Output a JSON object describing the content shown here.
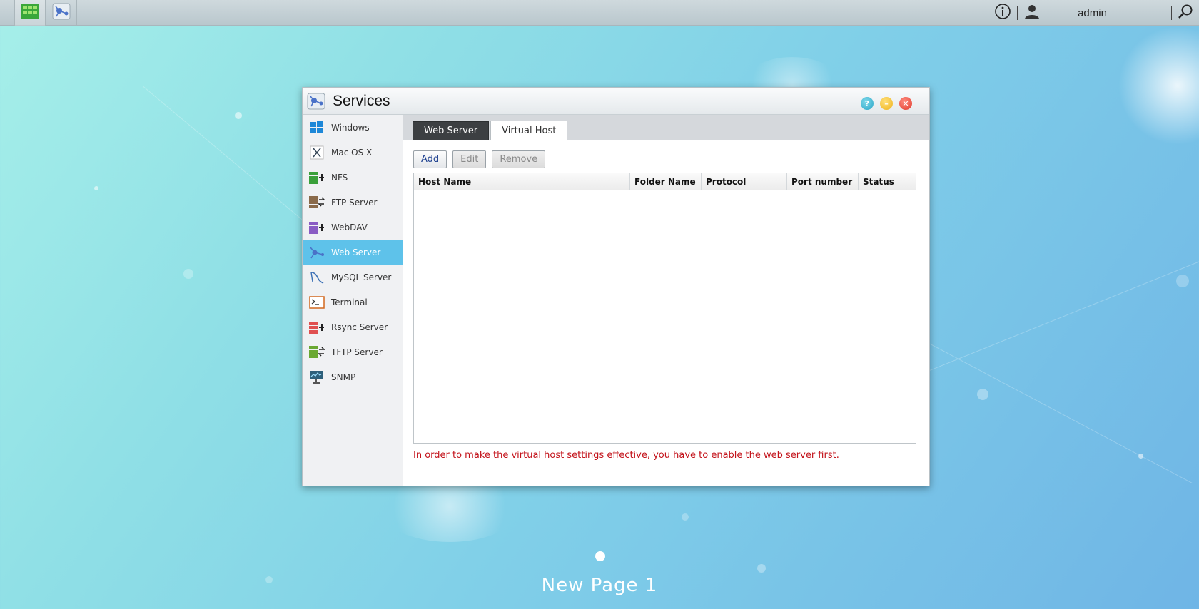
{
  "taskbar": {
    "apps": [
      {
        "name": "grid-app-icon"
      },
      {
        "name": "services-app-icon"
      }
    ],
    "user": "admin"
  },
  "window": {
    "title": "Services",
    "controls": [
      "help",
      "minimize",
      "close"
    ]
  },
  "sidebar": {
    "items": [
      {
        "label": "Windows",
        "icon": "windows-icon"
      },
      {
        "label": "Mac OS X",
        "icon": "mac-os-x-icon"
      },
      {
        "label": "NFS",
        "icon": "nfs-icon"
      },
      {
        "label": "FTP Server",
        "icon": "ftp-server-icon"
      },
      {
        "label": "WebDAV",
        "icon": "webdav-icon"
      },
      {
        "label": "Web Server",
        "icon": "web-server-icon",
        "active": true
      },
      {
        "label": "MySQL Server",
        "icon": "mysql-server-icon"
      },
      {
        "label": "Terminal",
        "icon": "terminal-icon"
      },
      {
        "label": "Rsync Server",
        "icon": "rsync-server-icon"
      },
      {
        "label": "TFTP Server",
        "icon": "tftp-server-icon"
      },
      {
        "label": "SNMP",
        "icon": "snmp-icon"
      }
    ]
  },
  "tabs": [
    {
      "label": "Web Server",
      "selected": false
    },
    {
      "label": "Virtual Host",
      "selected": true
    }
  ],
  "toolbar": {
    "add": "Add",
    "edit": "Edit",
    "remove": "Remove"
  },
  "grid": {
    "columns": [
      "Host Name",
      "Folder Name",
      "Protocol",
      "Port number",
      "Status"
    ],
    "rows": []
  },
  "notice": "In order to make the virtual host settings effective, you have to enable the web server first.",
  "desktop": {
    "page_label": "New Page 1"
  },
  "colors": {
    "accent": "#5ec2ea",
    "notice": "#c3121a",
    "tab_active": "#3c3f42"
  }
}
